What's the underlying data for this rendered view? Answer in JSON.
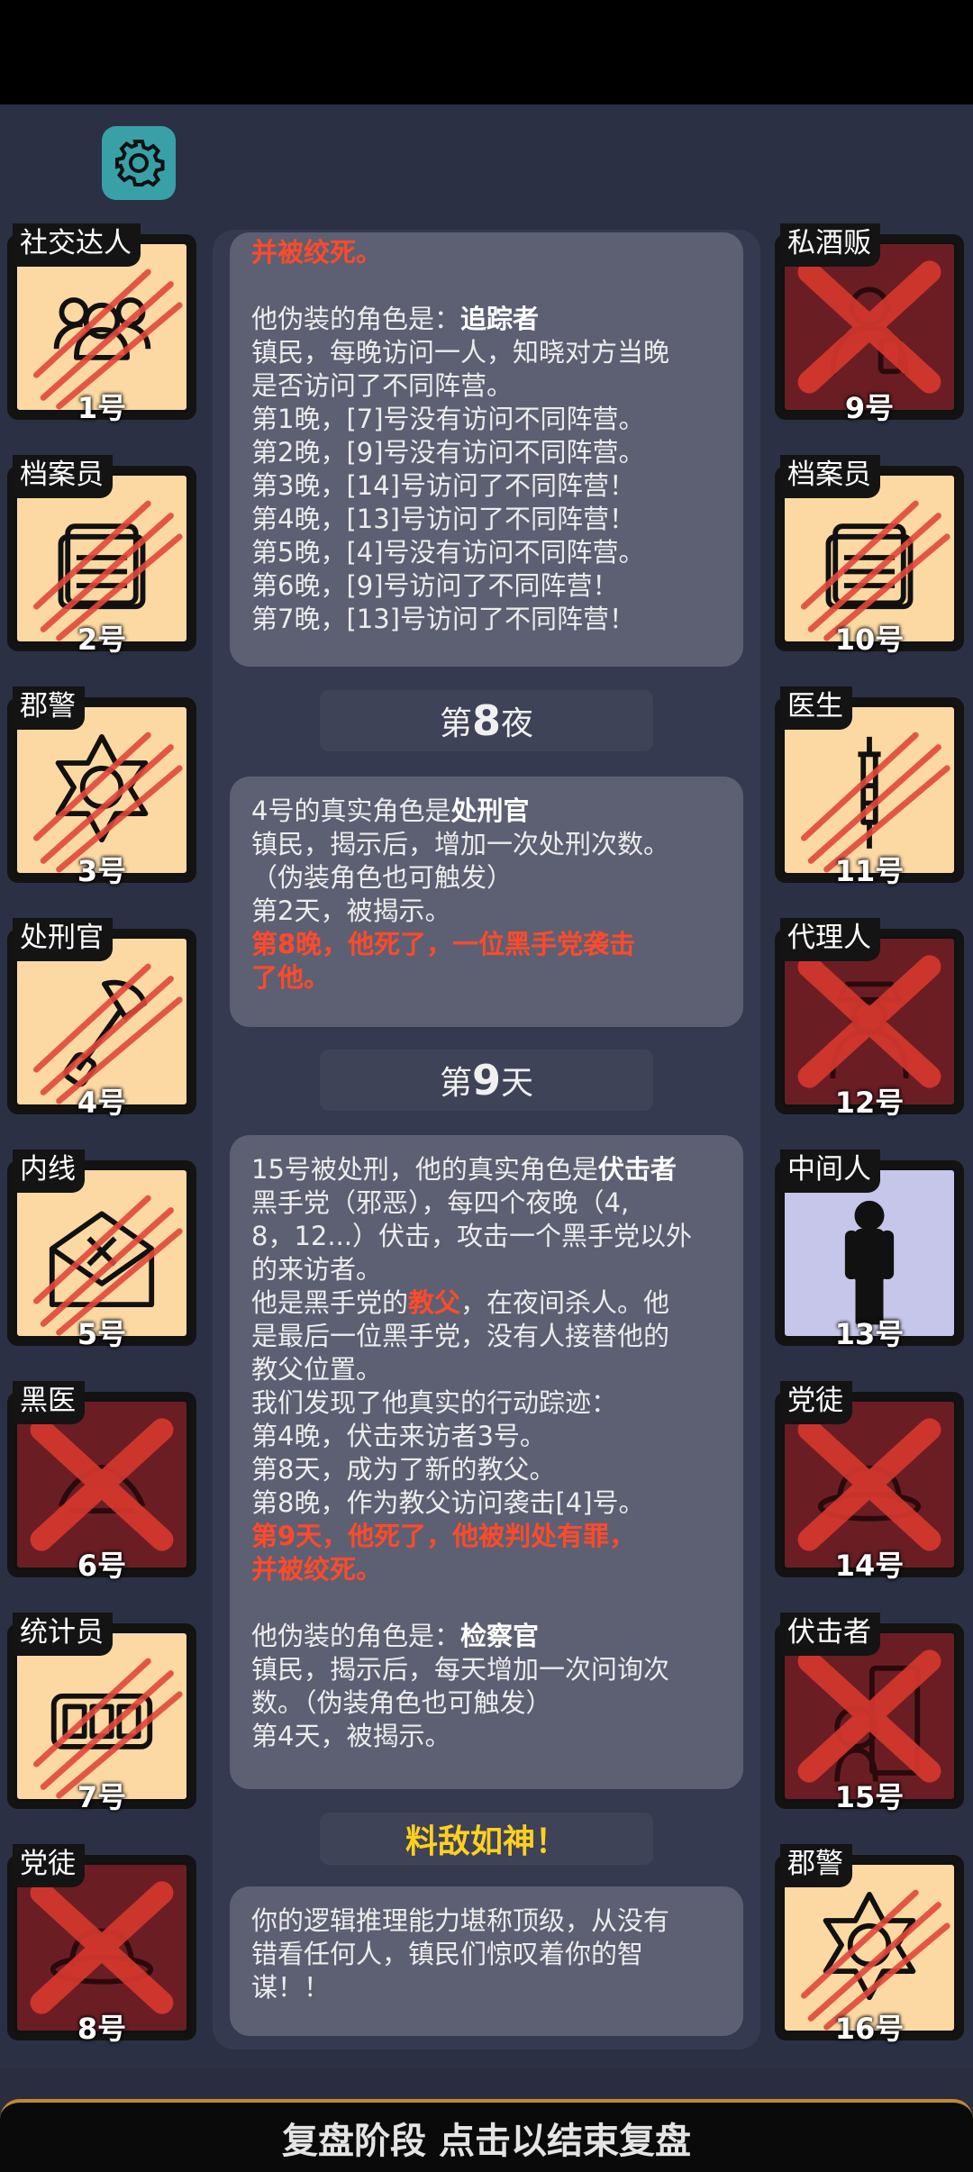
{
  "left_players": [
    {
      "role": "社交达人",
      "number": "1号",
      "state": "alive",
      "icon": "people-icon"
    },
    {
      "role": "档案员",
      "number": "2号",
      "state": "alive",
      "icon": "archive-icon"
    },
    {
      "role": "郡警",
      "number": "3号",
      "state": "alive",
      "icon": "sheriff-star-icon"
    },
    {
      "role": "处刑官",
      "number": "4号",
      "state": "alive",
      "icon": "axe-icon"
    },
    {
      "role": "内线",
      "number": "5号",
      "state": "alive",
      "icon": "envelope-icon"
    },
    {
      "role": "黑医",
      "number": "6号",
      "state": "dead",
      "icon": "black-doctor-icon"
    },
    {
      "role": "统计员",
      "number": "7号",
      "state": "alive",
      "icon": "counter-icon"
    },
    {
      "role": "党徒",
      "number": "8号",
      "state": "dead",
      "icon": "hat-icon"
    }
  ],
  "right_players": [
    {
      "role": "私酒贩",
      "number": "9号",
      "state": "dead",
      "icon": "bootlegger-icon"
    },
    {
      "role": "档案员",
      "number": "10号",
      "state": "alive",
      "icon": "archive-icon"
    },
    {
      "role": "医生",
      "number": "11号",
      "state": "alive",
      "icon": "syringe-icon"
    },
    {
      "role": "代理人",
      "number": "12号",
      "state": "dead",
      "icon": "agent-icon"
    },
    {
      "role": "中间人",
      "number": "13号",
      "state": "highlight",
      "icon": "person-silhouette-icon"
    },
    {
      "role": "党徒",
      "number": "14号",
      "state": "dead",
      "icon": "hat-icon"
    },
    {
      "role": "伏击者",
      "number": "15号",
      "state": "dead",
      "icon": "ambusher-icon"
    },
    {
      "role": "郡警",
      "number": "16号",
      "state": "alive",
      "icon": "sheriff-star-icon"
    }
  ],
  "log1": {
    "top_red": "并被绞死。",
    "disguise_prefix": "他伪装的角色是：",
    "disguise_role": "追踪者",
    "lines": [
      "镇民，每晚访问一人，知晓对方当晚",
      "是否访问了不同阵营。",
      "第1晚，[7]号没有访问不同阵营。",
      "第2晚，[9]号没有访问不同阵营。",
      "第3晚，[14]号访问了不同阵营！",
      "第4晚，[13]号访问了不同阵营！",
      "第5晚，[4]号没有访问不同阵营。",
      "第6晚，[9]号访问了不同阵营！",
      "第7晚，[13]号访问了不同阵营！"
    ]
  },
  "header_night8": {
    "pre": "第",
    "num": "8",
    "post": "夜"
  },
  "log2": {
    "intro": "4号的真实角色是",
    "role": "处刑官",
    "lines": [
      "镇民，揭示后，增加一次处刑次数。",
      "（伪装角色也可触发）",
      "第2天，被揭示。"
    ],
    "red_lines": [
      "第8晚，他死了，一位黑手党袭击",
      "了他。"
    ]
  },
  "header_day9": {
    "pre": "第",
    "num": "9",
    "post": "天"
  },
  "log3": {
    "intro": "15号被处刑，他的真实角色是",
    "role": "伏击者",
    "lines_a": [
      "黑手党（邪恶），每四个夜晚（4,",
      "8，12...）伏击，攻击一个黑手党以外",
      "的来访者。"
    ],
    "godfather_pre": "他是黑手党的",
    "godfather_word": "教父",
    "godfather_post": "，在夜间杀人。他",
    "lines_b": [
      "是最后一位黑手党，没有人接替他的",
      "教父位置。",
      "我们发现了他真实的行动踪迹：",
      "第4晚，伏击来访者3号。",
      "第8天，成为了新的教父。",
      "第8晚，作为教父访问袭击[4]号。"
    ],
    "red_lines": [
      "第9天，他死了，他被判处有罪，",
      "并被绞死。"
    ],
    "disguise_prefix": "他伪装的角色是：",
    "disguise_role": "检察官",
    "lines_c": [
      "镇民，揭示后，每天增加一次问询次",
      "数。（伪装角色也可触发）",
      "第4天，被揭示。"
    ]
  },
  "header_result": "料敌如神！",
  "log4": {
    "lines": [
      "你的逻辑推理能力堪称顶级，从没有",
      "错看任何人，镇民们惊叹着你的智",
      "谋！！"
    ]
  },
  "bottom_bar": "复盘阶段 点击以结束复盘",
  "colors": {
    "alive_card": "#fcd9a2",
    "dead_card": "#6a1e24",
    "highlight_card": "#c6c6ea",
    "red_text": "#ff4a2a",
    "gold_text": "#ffd020",
    "gear_button": "#39a0a8"
  }
}
